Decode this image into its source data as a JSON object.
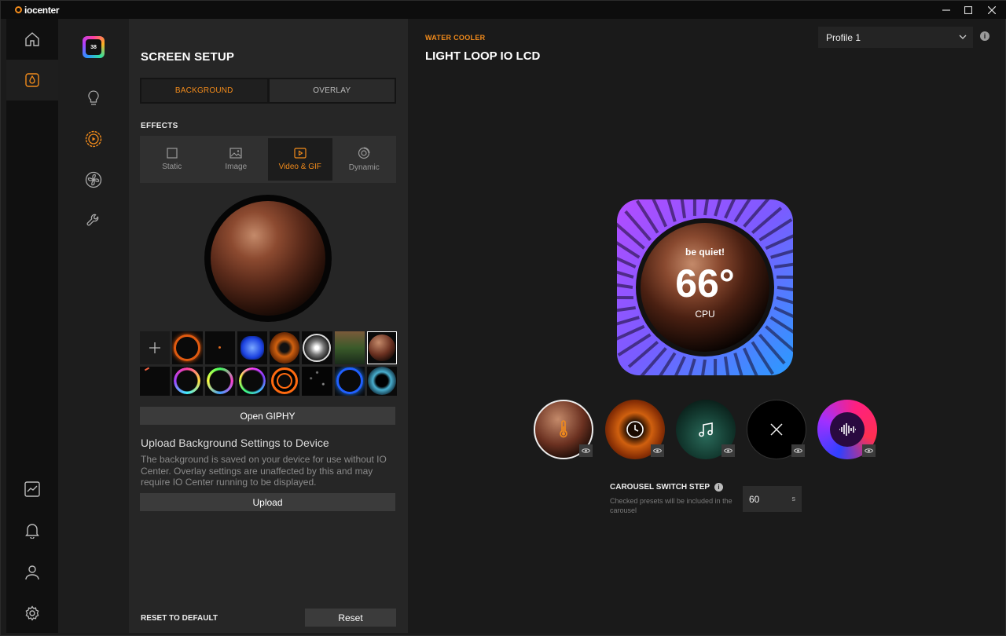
{
  "app": {
    "name": "iocenter"
  },
  "window_controls": {
    "minimize": "minimize-icon",
    "maximize": "maximize-icon",
    "close": "close-icon"
  },
  "rail": {
    "items": [
      "home-icon",
      "water-drop-icon"
    ],
    "bottom_items": [
      "chart-icon",
      "bell-icon",
      "user-icon",
      "settings-gear-icon"
    ],
    "active_index": 1
  },
  "subnav": {
    "device_badge": "38",
    "items": [
      "bulb-icon",
      "play-circle-icon",
      "fan-icon",
      "wrench-icon"
    ],
    "active_index": 1
  },
  "panel": {
    "title": "SCREEN SETUP",
    "tabs": [
      "BACKGROUND",
      "OVERLAY"
    ],
    "active_tab": 0,
    "effects_label": "EFFECTS",
    "effects": [
      "Static",
      "Image",
      "Video & GIF",
      "Dynamic"
    ],
    "active_effect": 2,
    "thumbnails_count": 15,
    "open_giphy": "Open GIPHY",
    "upload_title": "Upload Background Settings to Device",
    "upload_desc": "The background is saved on your device for use without IO Center. Overlay settings are unaffected by this and may require IO Center running to be displayed.",
    "upload_button": "Upload",
    "reset_label": "RESET TO DEFAULT",
    "reset_button": "Reset"
  },
  "main": {
    "category": "WATER COOLER",
    "title": "LIGHT LOOP IO LCD",
    "profile": "Profile 1",
    "lcd": {
      "brand": "be quiet!",
      "value": "66°",
      "label": "CPU"
    },
    "presets": [
      {
        "icon": "thermometer-icon",
        "selected": true
      },
      {
        "icon": "clock-icon",
        "selected": false
      },
      {
        "icon": "music-note-icon",
        "selected": false
      },
      {
        "icon": "close-icon",
        "selected": false
      },
      {
        "icon": "audio-wave-icon",
        "selected": false
      }
    ],
    "carousel": {
      "label": "CAROUSEL SWITCH STEP",
      "desc": "Checked presets will be included in the carousel",
      "value": "60",
      "unit": "s"
    }
  },
  "colors": {
    "accent": "#f28b1b"
  }
}
